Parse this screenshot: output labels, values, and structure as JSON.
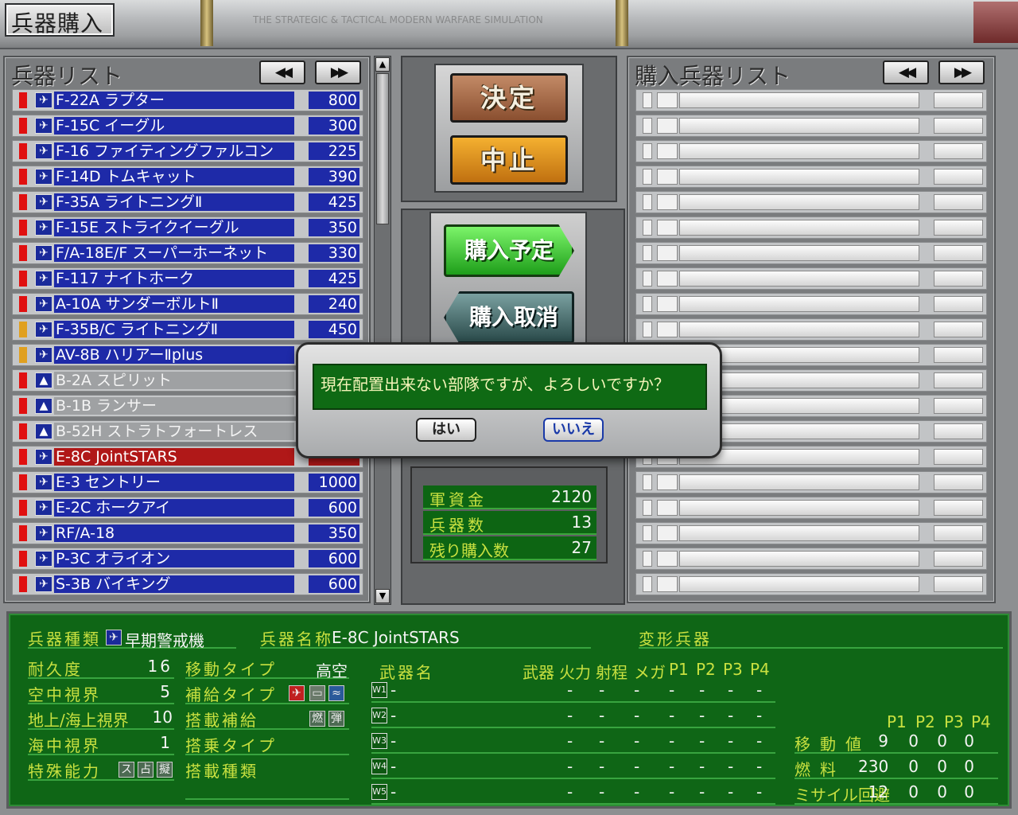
{
  "header": {
    "title": "兵器購入",
    "subtitle": "THE STRATEGIC & TACTICAL MODERN WARFARE SIMULATION"
  },
  "weapon_list": {
    "title": "兵器リスト",
    "prev_label": "◀◀",
    "next_label": "▶▶",
    "items": [
      {
        "name": "F-22A ラプター",
        "price": "800",
        "flag": "#e01010",
        "selected": false
      },
      {
        "name": "F-15C イーグル",
        "price": "300",
        "flag": "#e01010",
        "selected": false
      },
      {
        "name": "F-16 ファイティングファルコン",
        "price": "225",
        "flag": "#e01010",
        "selected": false
      },
      {
        "name": "F-14D トムキャット",
        "price": "390",
        "flag": "#e01010",
        "selected": false
      },
      {
        "name": "F-35A ライトニングⅡ",
        "price": "425",
        "flag": "#e01010",
        "selected": false
      },
      {
        "name": "F-15E ストライクイーグル",
        "price": "350",
        "flag": "#e01010",
        "selected": false
      },
      {
        "name": "F/A-18E/F スーパーホーネット",
        "price": "330",
        "flag": "#e01010",
        "selected": false
      },
      {
        "name": "F-117 ナイトホーク",
        "price": "425",
        "flag": "#e01010",
        "selected": false
      },
      {
        "name": "A-10A サンダーボルトⅡ",
        "price": "240",
        "flag": "#e01010",
        "selected": false
      },
      {
        "name": "F-35B/C ライトニングⅡ",
        "price": "450",
        "flag": "#e0a020",
        "selected": false
      },
      {
        "name": "AV-8B ハリアーⅡplus",
        "price": "",
        "flag": "#e0a020",
        "selected": false
      },
      {
        "name": "B-2A スピリット",
        "price": "",
        "flag": "#e01010",
        "selected": false,
        "gray": true
      },
      {
        "name": "B-1B ランサー",
        "price": "",
        "flag": "#e01010",
        "selected": false,
        "gray": true
      },
      {
        "name": "B-52H ストラトフォートレス",
        "price": "",
        "flag": "#e01010",
        "selected": false,
        "gray": true
      },
      {
        "name": "E-8C JointSTARS",
        "price": "",
        "flag": "#e01010",
        "selected": true
      },
      {
        "name": "E-3 セントリー",
        "price": "1000",
        "flag": "#e01010",
        "selected": false
      },
      {
        "name": "E-2C ホークアイ",
        "price": "600",
        "flag": "#e01010",
        "selected": false
      },
      {
        "name": "RF/A-18",
        "price": "350",
        "flag": "#e01010",
        "selected": false
      },
      {
        "name": "P-3C オライオン",
        "price": "600",
        "flag": "#e01010",
        "selected": false
      },
      {
        "name": "S-3B バイキング",
        "price": "600",
        "flag": "#e01010",
        "selected": false
      }
    ]
  },
  "purchase_list": {
    "title": "購入兵器リスト",
    "prev_label": "◀◀",
    "next_label": "▶▶"
  },
  "buttons": {
    "confirm": "決定",
    "cancel": "中止",
    "reserve": "購入予定",
    "unreserve": "購入取消"
  },
  "dialog": {
    "message": "現在配置出来ない部隊ですが、よろしいですか？",
    "yes": "はい",
    "no": "いいえ"
  },
  "money": {
    "funds_label": "軍資金",
    "funds_value": "2120",
    "count_label": "兵器数",
    "count_value": "13",
    "remaining_label": "残り購入数",
    "remaining_value": "27"
  },
  "info": {
    "type_label": "兵器種類",
    "type_value": "早期警戒機",
    "name_label": "兵器名称",
    "name_value": "E-8C JointSTARS",
    "transform_label": "変形兵器",
    "stats": [
      {
        "label": "耐久度",
        "value": "16"
      },
      {
        "label": "空中視界",
        "value": "5"
      },
      {
        "label": "地上/海上視界",
        "value": "10"
      },
      {
        "label": "海中視界",
        "value": "1"
      },
      {
        "label": "特殊能力",
        "value": ""
      }
    ],
    "special_icons": [
      "ス",
      "占",
      "擬"
    ],
    "move_type_label": "移動タイプ",
    "move_type_value": "高空",
    "supply_type_label": "補給タイプ",
    "onboard_supply_label": "搭載補給",
    "onboard_supply_icons": [
      "燃",
      "弾"
    ],
    "board_type_label": "搭乗タイプ",
    "board_kind_label": "搭載種類",
    "weapon_header": {
      "name": "武器名",
      "weapon": "武器",
      "fire": "火力",
      "range": "射程",
      "mega": "メガ",
      "p1": "P1",
      "p2": "P2",
      "p3": "P3",
      "p4": "P4"
    },
    "weapon_slots": [
      {
        "slot": "W1",
        "name": "-",
        "vals": [
          "-",
          "-",
          "-",
          "-",
          "-",
          "-",
          "-"
        ]
      },
      {
        "slot": "W2",
        "name": "-",
        "vals": [
          "-",
          "-",
          "-",
          "-",
          "-",
          "-",
          "-"
        ]
      },
      {
        "slot": "W3",
        "name": "-",
        "vals": [
          "-",
          "-",
          "-",
          "-",
          "-",
          "-",
          "-"
        ]
      },
      {
        "slot": "W4",
        "name": "-",
        "vals": [
          "-",
          "-",
          "-",
          "-",
          "-",
          "-",
          "-"
        ]
      },
      {
        "slot": "W5",
        "name": "-",
        "vals": [
          "-",
          "-",
          "-",
          "-",
          "-",
          "-",
          "-"
        ]
      }
    ],
    "perf_header": [
      "P1",
      "P2",
      "P3",
      "P4"
    ],
    "perf": [
      {
        "label": "移動値",
        "vals": [
          "9",
          "0",
          "0",
          "0"
        ]
      },
      {
        "label": "燃料",
        "vals": [
          "230",
          "0",
          "0",
          "0"
        ]
      },
      {
        "label": "ミサイル回避",
        "vals": [
          "12",
          "0",
          "0",
          "0"
        ]
      }
    ]
  }
}
